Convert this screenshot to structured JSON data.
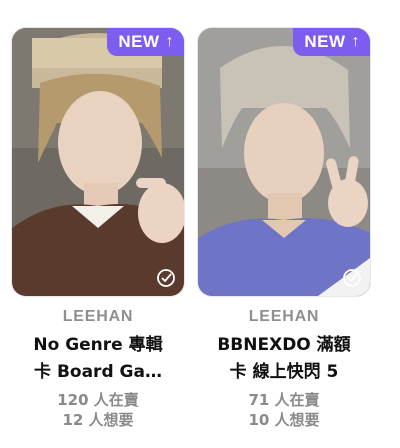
{
  "cards": [
    {
      "badge": "NEW",
      "badge_arrow": "↑",
      "artist": "LEEHAN",
      "title": "No Genre 專輯\n卡 Board Ga…",
      "sellers": "120 人在賣",
      "wanted": "12 人想要"
    },
    {
      "badge": "NEW",
      "badge_arrow": "↑",
      "artist": "LEEHAN",
      "title": "BBNEXDO 滿額\n卡 線上快閃 5",
      "sellers": "71 人在賣",
      "wanted": "10 人想要"
    }
  ],
  "colors": {
    "badge": "#7c5df0",
    "title": "#111111",
    "meta": "#8a8a8a"
  },
  "icons": [
    "arrow-up-icon",
    "check-circle-icon"
  ]
}
